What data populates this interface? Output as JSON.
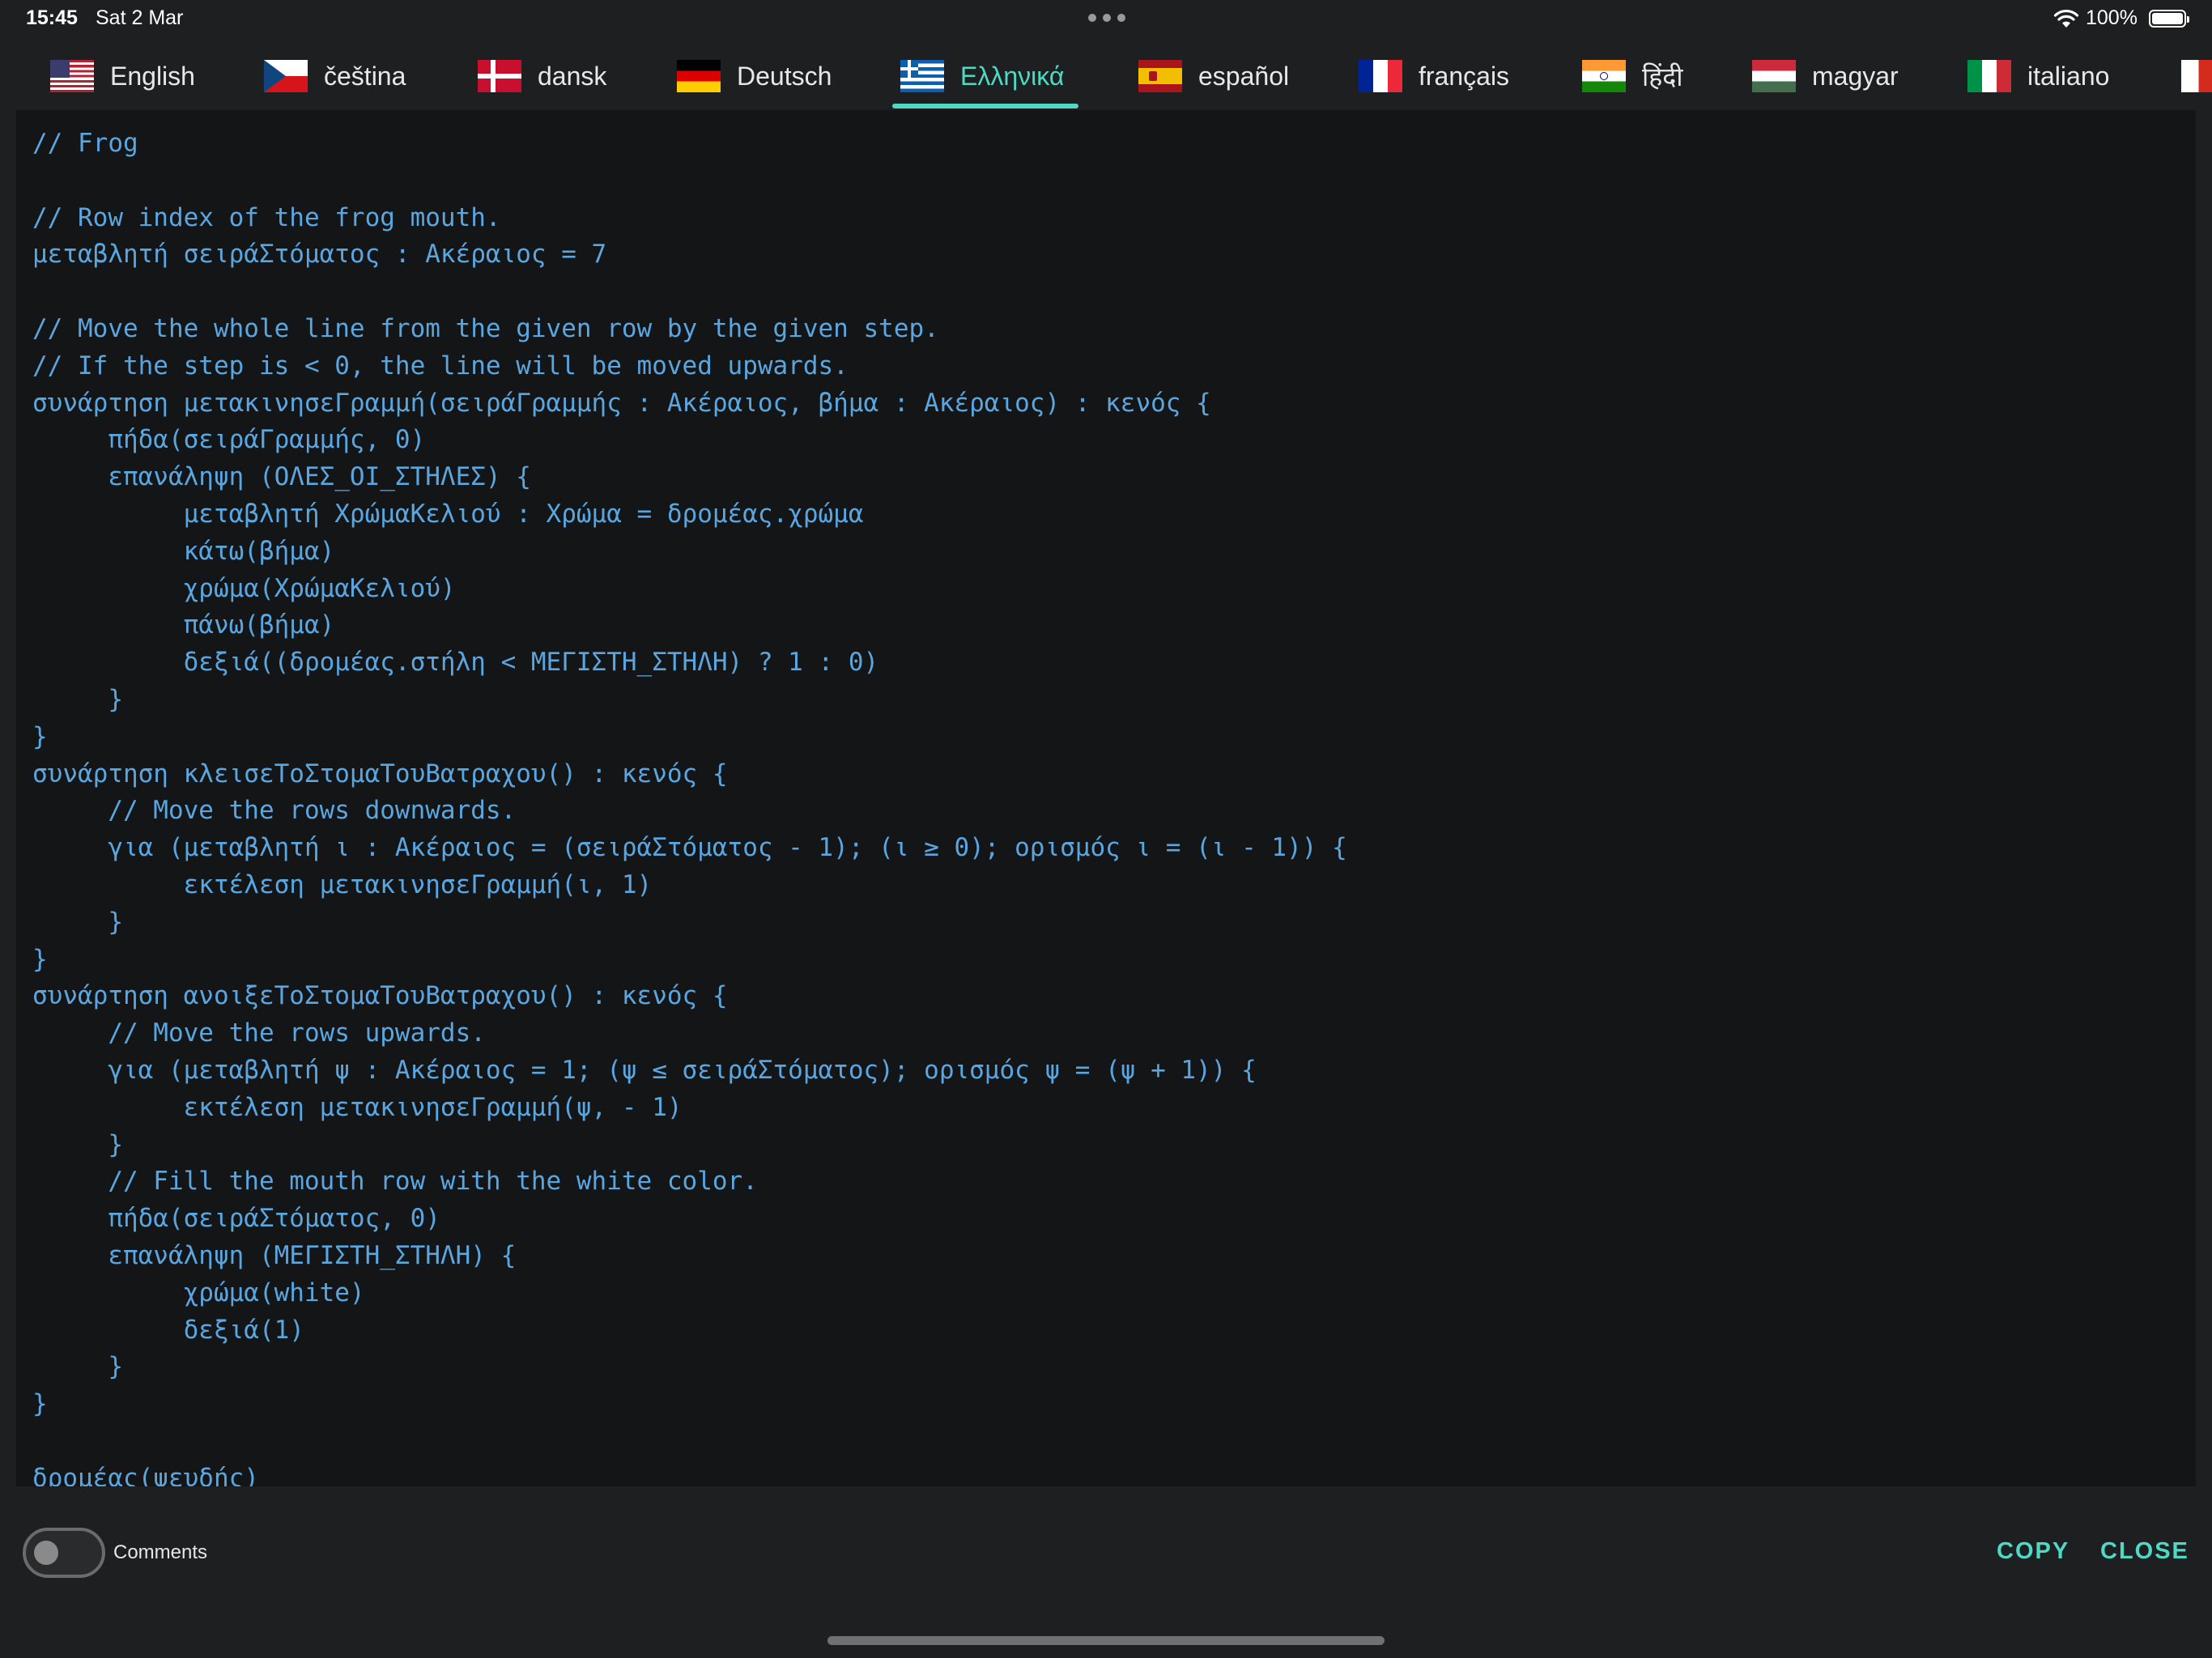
{
  "status_bar": {
    "time": "15:45",
    "date": "Sat 2 Mar",
    "battery": "100%",
    "icons": [
      "multitasking-dots",
      "wifi-icon",
      "battery-icon"
    ]
  },
  "languages": [
    {
      "label": "English",
      "flag": "us-flag-icon"
    },
    {
      "label": "čeština",
      "flag": "czech-flag-icon"
    },
    {
      "label": "dansk",
      "flag": "denmark-flag-icon"
    },
    {
      "label": "Deutsch",
      "flag": "germany-flag-icon"
    },
    {
      "label": "Ελληνικά",
      "flag": "greece-flag-icon",
      "active": true
    },
    {
      "label": "español",
      "flag": "spain-flag-icon"
    },
    {
      "label": "français",
      "flag": "france-flag-icon"
    },
    {
      "label": "हिंदी",
      "flag": "india-flag-icon"
    },
    {
      "label": "magyar",
      "flag": "hungary-flag-icon"
    },
    {
      "label": "italiano",
      "flag": "italy-flag-icon"
    }
  ],
  "colors": {
    "accent": "#4fd9c4",
    "code_text": "#5aa6e0",
    "code_background": "#141516",
    "app_background": "#1e1f20"
  },
  "code": {
    "lines": [
      "// Frog",
      "",
      "// Row index of the frog mouth.",
      "μεταβλητή σειράΣτόματος : Ακέραιος = 7",
      "",
      "// Move the whole line from the given row by the given step.",
      "// If the step is < 0, the line will be moved upwards.",
      "συνάρτηση μετακινησεΓραμμή(σειράΓραμμής : Ακέραιος, βήμα : Ακέραιος) : κενός {",
      "     πήδα(σειράΓραμμής, 0)",
      "     επανάληψη (ΟΛΕΣ_ΟΙ_ΣΤΗΛΕΣ) {",
      "          μεταβλητή ΧρώμαΚελιού : Χρώμα = δρομέας.χρώμα",
      "          κάτω(βήμα)",
      "          χρώμα(ΧρώμαΚελιού)",
      "          πάνω(βήμα)",
      "          δεξιά((δρομέας.στήλη < ΜΕΓΙΣΤΗ_ΣΤΗΛΗ) ? 1 : 0)",
      "     }",
      "}",
      "συνάρτηση κλεισεΤοΣτομαΤουΒατραχου() : κενός {",
      "     // Move the rows downwards.",
      "     για (μεταβλητή ι : Ακέραιος = (σειράΣτόματος - 1); (ι ≥ 0); ορισμός ι = (ι - 1)) {",
      "          εκτέλεση μετακινησεΓραμμή(ι, 1)",
      "     }",
      "}",
      "συνάρτηση ανοιξεΤοΣτομαΤουΒατραχου() : κενός {",
      "     // Move the rows upwards.",
      "     για (μεταβλητή ψ : Ακέραιος = 1; (ψ ≤ σειράΣτόματος); ορισμός ψ = (ψ + 1)) {",
      "          εκτέλεση μετακινησεΓραμμή(ψ, - 1)",
      "     }",
      "     // Fill the mouth row with the white color.",
      "     πήδα(σειράΣτόματος, 0)",
      "     επανάληψη (ΜΕΓΙΣΤΗ_ΣΤΗΛΗ) {",
      "          χρώμα(white)",
      "          δεξιά(1)",
      "     }",
      "}",
      "",
      "δρομέας(ψευδής)"
    ]
  },
  "footer": {
    "comments_label": "Comments",
    "comments_enabled": false,
    "copy_label": "COPY",
    "close_label": "CLOSE"
  }
}
